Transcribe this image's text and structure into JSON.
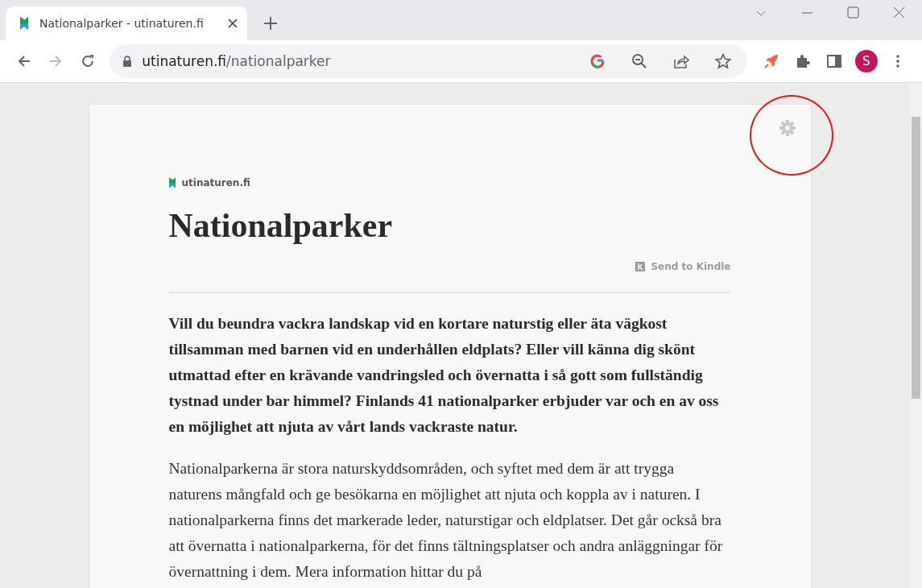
{
  "tab": {
    "title": "Nationalparker - utinaturen.fi",
    "selected": true
  },
  "address": {
    "host": "utinaturen.fi",
    "path": "/nationalparker"
  },
  "profile": {
    "initial": "S"
  },
  "article": {
    "site": "utinaturen.fi",
    "title": "Nationalparker",
    "send_to_kindle": "Send to Kindle",
    "lead": "Vill du beundra vackra landskap vid en kortare naturstig eller äta vägkost tillsamman med barnen vid en underhållen eldplats? Eller vill känna dig skönt utmattad efter en krävande vandringsled och övernatta i så gott som fullständig tystnad under bar himmel? Finlands 41 nationalparker erbjuder var och en av oss en möjlighet att njuta av vårt lands vackraste natur.",
    "body": "Nationalparkerna är stora naturskyddsområden, och syftet med dem är att trygga naturens mångfald och ge besökarna en möjlighet att njuta och koppla av i naturen. I nationalparkerna finns det markerade leder, naturstigar och eldplatser. Det går också bra att övernatta i nationalparkerna, för det finns tältningsplatser och andra anläggningar för övernattning i dem. Mera information hittar du på"
  }
}
